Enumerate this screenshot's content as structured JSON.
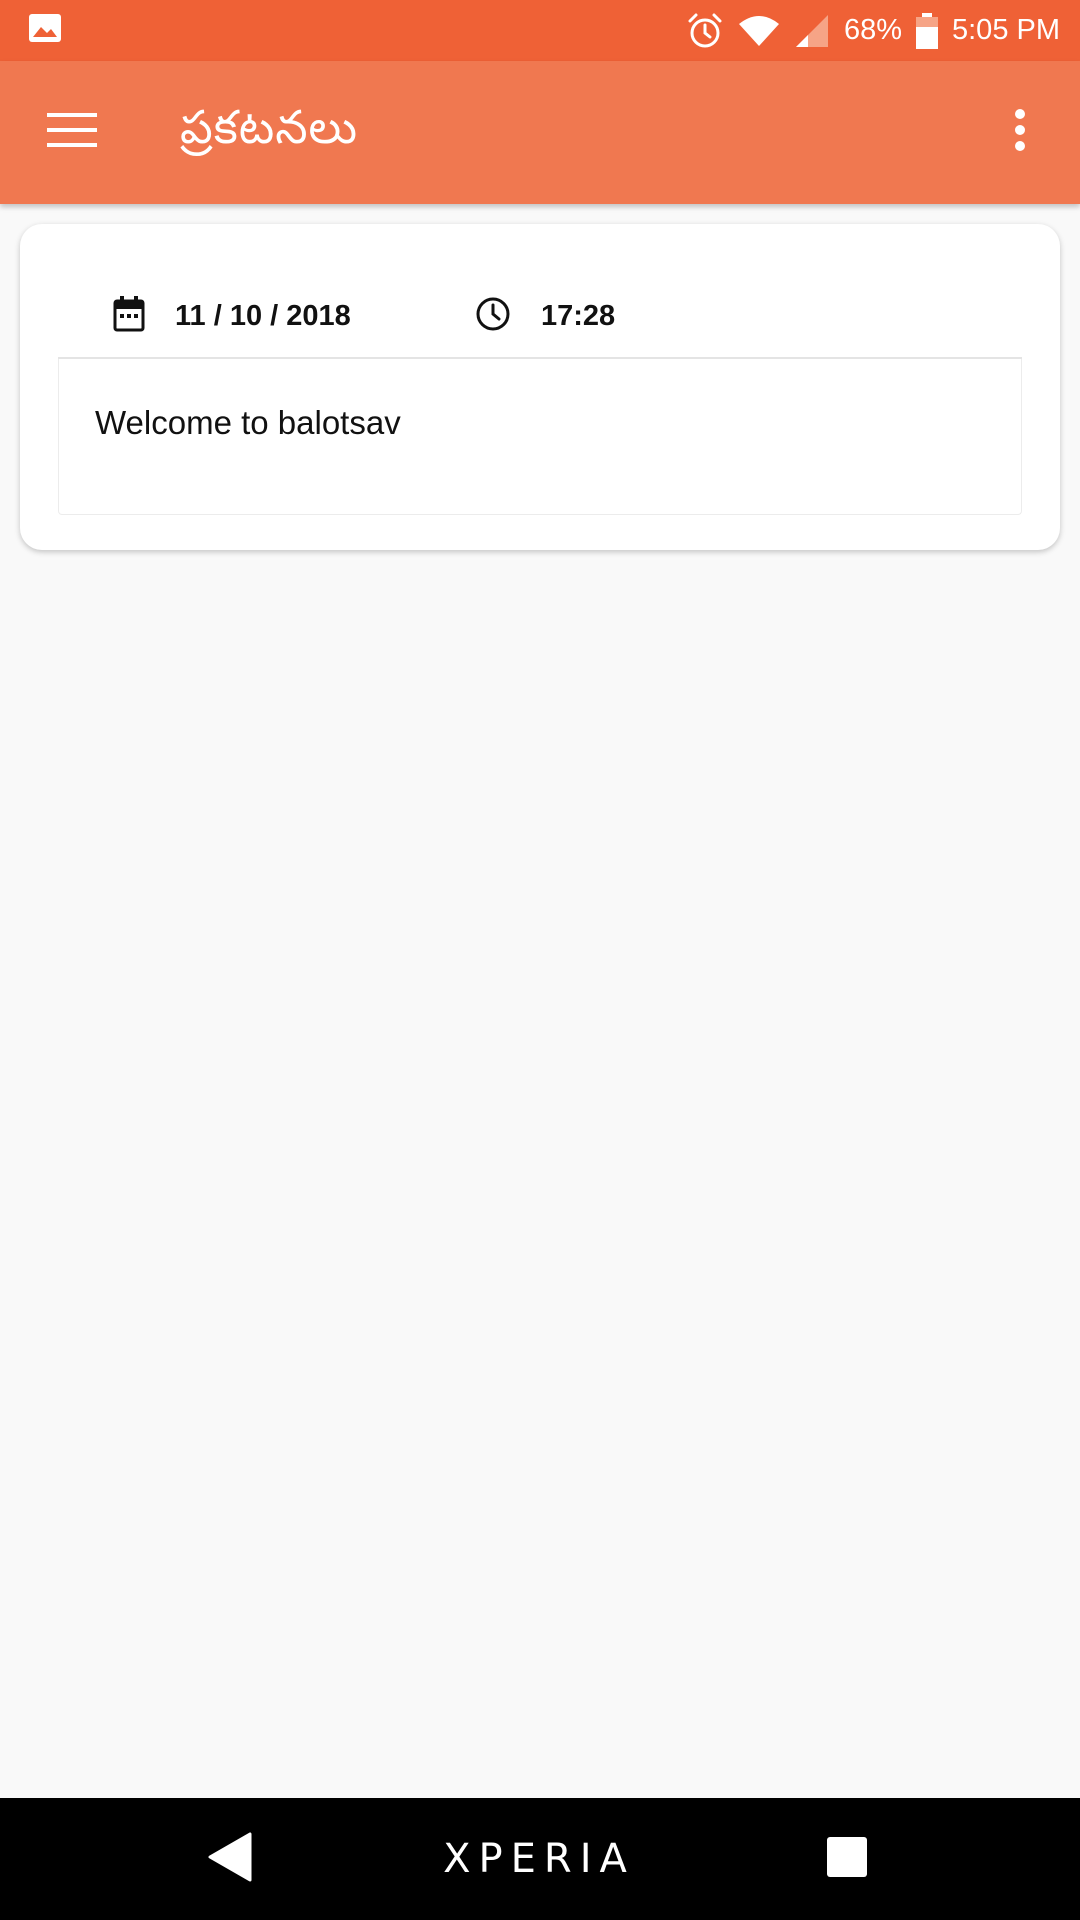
{
  "status_bar": {
    "battery": "68%",
    "time": "5:05 PM",
    "icons": [
      "image-icon",
      "alarm-icon",
      "wifi-icon",
      "signal-icon",
      "battery-icon"
    ],
    "color": "#ef6136"
  },
  "app_bar": {
    "title": "ప్రకటనలు",
    "menu_icon": "hamburger-menu-icon",
    "overflow_icon": "more-vert-icon",
    "color": "#f07850"
  },
  "announcements": [
    {
      "date": "11 / 10 / 2018",
      "time": "17:28",
      "message": "Welcome to balotsav"
    }
  ],
  "nav_bar": {
    "brand": "XPERIA",
    "icons": [
      "back-icon",
      "recents-icon"
    ]
  }
}
